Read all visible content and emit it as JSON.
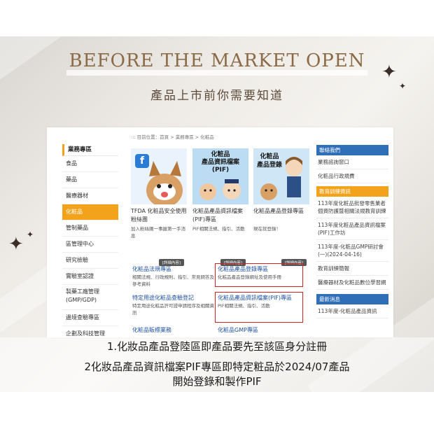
{
  "poster": {
    "headline": "BEFORE THE MARKET OPEN",
    "subtitle": "產品上市前你需要知道",
    "caption_line1": "1.化妝品產品登陸區即產品要先至該區身分註冊",
    "caption_line2": "2化妝品產品資訊檔案PIF專區即特定粧品於2024/07產品",
    "caption_line3": "開始登錄和製作PIF"
  },
  "website": {
    "breadcrumb": "::: 目前位置：首頁 > 業務專區 > 化粧品",
    "sidebar": {
      "title": "業務專區",
      "items": [
        "食品",
        "藥品",
        "醫療器材",
        "化粧品",
        "管制藥品",
        "區管理中心",
        "研究檢驗",
        "實驗室認證",
        "製藥工廠管理(GMP/GDP)",
        "邊境查驗專區",
        "企劃及科技管理"
      ],
      "active_index": 3
    },
    "cards": [
      {
        "title": "TFDA 化粧品安全使用 粉絲團",
        "desc": "加入粉絲團一事握第一手消息",
        "more": "[詳細內容]",
        "art_title": "",
        "icon": "facebook-icon",
        "color": "#2a7cd6"
      },
      {
        "title": "化粧品產品資訊檔案(PIF)專區",
        "desc": "PIF相關法規、指引、活動",
        "more": "[詳細內容]",
        "art_title": "化粧品\n產品資訊檔案\n(PIF)",
        "color": "#6aaede"
      },
      {
        "title": "化粧品產品登錄專區",
        "desc": "現在就登錄！",
        "more": "[詳細內容]",
        "art_title": "化粧品\n產品登錄",
        "color": "#79b9e3"
      }
    ],
    "links": [
      {
        "title": "化粧品法規專區",
        "desc": "相關法規、行政規則、指引、常見問答及參考資料",
        "boxed": false
      },
      {
        "title": "化粧品產品登錄專區",
        "desc": "化粧品產品登錄網址及使用手冊",
        "boxed": true
      },
      {
        "title": "特定用途化粧品查驗登記",
        "desc": "特定用途化粧品許可證申請程序及相關資訊",
        "boxed": false
      },
      {
        "title": "化粧品產品資訊檔案(PIF)專區",
        "desc": "PIF相關法規、指引、活動",
        "boxed": true
      },
      {
        "title": "化粧品販標業務",
        "desc": "",
        "boxed": false
      },
      {
        "title": "化粧品GMP專區",
        "desc": "",
        "boxed": false
      }
    ],
    "right": {
      "contact": {
        "head": "聯絡我們",
        "items": [
          "業務諮詢窗口",
          "化粧品行政規費"
        ],
        "color": "#2f6fb8"
      },
      "training": {
        "head": "教育訓練資訊",
        "items": [
          "113年度化粧品批發零售業者個資防護暨相關法規教育訓練",
          "113年度化粧品產品資訊檔案(PIF)工作坊",
          "113年度-化粧品GMP研討會(一)(2024-04-16)",
          "教育訓練簡報",
          "醫療器材及化粧品數位學習網"
        ],
        "color": "#f3a31b"
      },
      "news": {
        "head": "最新消息",
        "items": [
          "113年度-化粧品產品資訊"
        ],
        "color": "#2f6fb8"
      }
    }
  },
  "colors": {
    "headline": "#8a6a47",
    "accent_orange": "#f3a31b",
    "link_blue": "#1e50a0",
    "redbox": "#d42222"
  }
}
